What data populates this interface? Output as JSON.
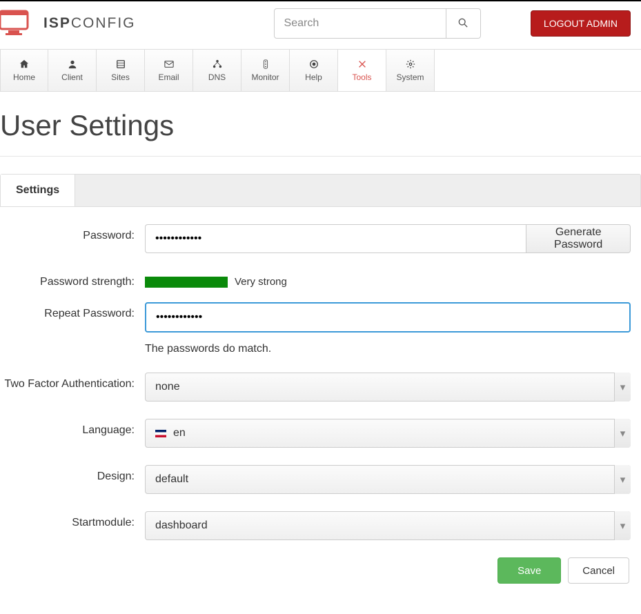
{
  "header": {
    "logo_bold": "ISP",
    "logo_light": "CONFIG",
    "search_placeholder": "Search",
    "logout_label": "LOGOUT ADMIN"
  },
  "nav": {
    "items": [
      {
        "label": "Home",
        "icon": "home-icon"
      },
      {
        "label": "Client",
        "icon": "client-icon"
      },
      {
        "label": "Sites",
        "icon": "sites-icon"
      },
      {
        "label": "Email",
        "icon": "email-icon"
      },
      {
        "label": "DNS",
        "icon": "dns-icon"
      },
      {
        "label": "Monitor",
        "icon": "monitor-icon"
      },
      {
        "label": "Help",
        "icon": "help-icon"
      },
      {
        "label": "Tools",
        "icon": "tools-icon"
      },
      {
        "label": "System",
        "icon": "system-icon"
      }
    ],
    "active_index": 7
  },
  "page": {
    "title": "User Settings",
    "tab_label": "Settings"
  },
  "form": {
    "password_label": "Password:",
    "password_value": "••••••••••••",
    "generate_label": "Generate Password",
    "strength_label": "Password strength:",
    "strength_text": "Very strong",
    "repeat_label": "Repeat Password:",
    "repeat_value": "••••••••••••",
    "match_message": "The passwords do match.",
    "twofa_label": "Two Factor Authentication:",
    "twofa_value": "none",
    "language_label": "Language:",
    "language_value": "en",
    "design_label": "Design:",
    "design_value": "default",
    "startmodule_label": "Startmodule:",
    "startmodule_value": "dashboard",
    "save_label": "Save",
    "cancel_label": "Cancel"
  }
}
